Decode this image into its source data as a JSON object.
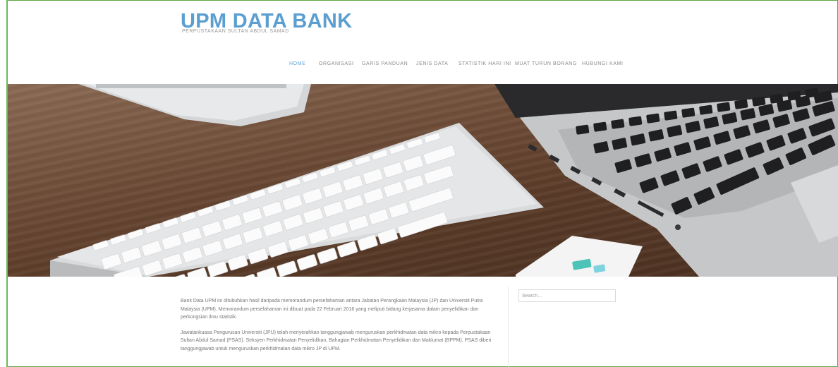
{
  "header": {
    "site_title": "UPM DATA BANK",
    "tagline": "PERPUSTAKAAN SULTAN ABDUL SAMAD"
  },
  "nav": {
    "items": [
      {
        "label": "HOME",
        "active": true
      },
      {
        "label": "ORGANISASI",
        "active": false
      },
      {
        "label": "GARIS PANDUAN",
        "active": false
      },
      {
        "label": "JENIS DATA",
        "active": false
      },
      {
        "label": "STATISTIK HARI INI",
        "active": false
      },
      {
        "label": "MUAT TURUN BORANG",
        "active": false
      },
      {
        "label": "HUBUNGI KAMI",
        "active": false
      }
    ]
  },
  "hero": {
    "icon": "laptop-keyboard-desk-photo"
  },
  "content": {
    "paragraphs": [
      "Bank Data UPM ini ditubuhkan hasil daripada memorandum persefahaman antara Jabatan Perangkaan Malaysia (JP) dan Universiti Putra Malaysia (UPM). Memorandum persefahaman ini dibuat pada 22 Februari 2016 yang meliputi bidang kerjasama dalam penyelidikan dan perkongsian ilmu statistik.",
      "Jawatankuasa Pengurusan Universiti (JPU) telah menyerahkan tanggungjawab menguruskan perkhidmatan data mikro kepada Perpustakaan Sultan Abdul Samad (PSAS). Seksyen Perkhidmatan Penyelidikan, Bahagian Perkhidmatan Penyelidikan dan Maklumat (BPPM), PSAS diberi tanggungjawab untuk menguruskan perkhidmatan data mikro JP di UPM."
    ]
  },
  "sidebar": {
    "search_placeholder": "Search..."
  },
  "colors": {
    "brand": "#5b9fd1",
    "frame": "#5aa647",
    "text": "#777777"
  }
}
